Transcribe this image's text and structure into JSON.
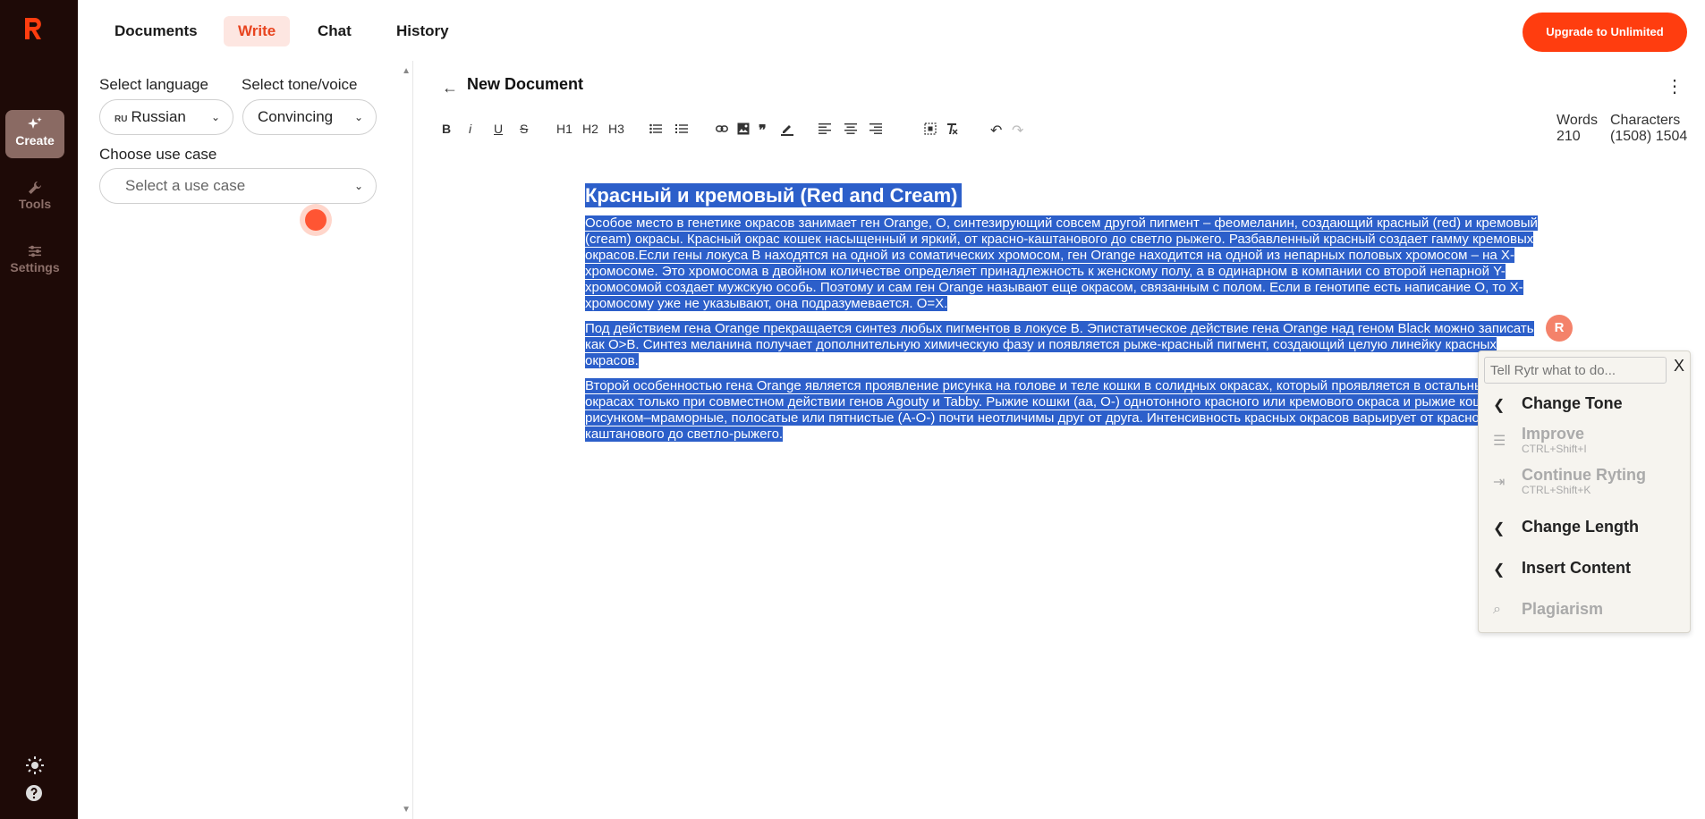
{
  "rail": {
    "items": [
      {
        "label": "Create",
        "icon": "sparkle-icon"
      },
      {
        "label": "Tools",
        "icon": "wrench-icon"
      },
      {
        "label": "Settings",
        "icon": "sliders-icon"
      }
    ]
  },
  "topbar": {
    "tabs": [
      "Documents",
      "Write",
      "Chat",
      "History"
    ],
    "active_tab": "Write",
    "upgrade_label": "Upgrade to Unlimited"
  },
  "panel": {
    "language_label": "Select language",
    "language_code": "RU",
    "language_value": "Russian",
    "tone_label": "Select tone/voice",
    "tone_value": "Convincing",
    "usecase_label": "Choose use case",
    "usecase_placeholder": "Select a use case"
  },
  "editor": {
    "title": "New Document",
    "toolbar": [
      "B",
      "i",
      "U",
      "S",
      "H1",
      "H2",
      "H3"
    ],
    "words_label": "Words",
    "words_value": "210",
    "chars_label": "Characters",
    "chars_value": "(1508) 1504"
  },
  "document": {
    "heading": "Красный и кремовый (Red and Cream)",
    "p1": "Особое место в генетике окрасов занимает ген Orange, O, синтезирующий совсем другой пигмент – феомеланин, создающий красный (red) и кремовый (cream) окрасы. Красный окрас кошек насыщенный и яркий, от красно-каштанового до светло рыжего. Разбавленный красный создает гамму кремовых окрасов.Если гены локуса B находятся на одной из соматических хромосом, ген Orange находится на одной из непарных половых хромосом – на X-хромосоме. Это хромосома в двойном количестве определяет принадлежность к женскому полу, а в одинарном в компании со второй непарной Y-хромосомой создает мужскую особь. Поэтому и сам ген Orange называют еще окрасом, связанным с полом. Если в генотипе есть написание O, то X-хромосому уже не указывают, она подразумевается. O=X.",
    "p2": "Под действием гена Orange прекращается синтез любых пигментов в локусе B. Эпистатическое действие гена Orange над геном Black можно записать как O>B. Синтез меланина получает дополнительную химическую фазу и появляется рыже-красный пигмент, создающий целую линейку красных окрасов.",
    "p3": "Второй особенностью гена Orange является проявление рисунка на голове и теле кошки в солидных окрасах, который проявляется в остальных окрасах только при совместном действии генов Agouty и Tabby. Рыжие кошки (aa, O-) однотонного красного или кремового окраса и рыжие кошки с рисунком–мраморные, полосатые или пятнистые (A-O-) почти неотличимы друг от друга. Интенсивность красных окрасов варьирует от красно-каштанового до светло-рыжего."
  },
  "popup": {
    "ask_placeholder": "Tell Rytr what to do...",
    "close": "X",
    "items": [
      {
        "label": "Change Tone",
        "shortcut": "",
        "enabled": true
      },
      {
        "label": "Improve",
        "shortcut": "CTRL+Shift+I",
        "enabled": false
      },
      {
        "label": "Continue Ryting",
        "shortcut": "CTRL+Shift+K",
        "enabled": false
      },
      {
        "label": "Change Length",
        "shortcut": "",
        "enabled": true
      },
      {
        "label": "Insert Content",
        "shortcut": "",
        "enabled": true
      },
      {
        "label": "Plagiarism",
        "shortcut": "",
        "enabled": false
      }
    ]
  },
  "badge": "R",
  "colors": {
    "accent": "#ff3d0f",
    "rail_bg": "#1e0a07",
    "selection": "#2c5fca"
  }
}
